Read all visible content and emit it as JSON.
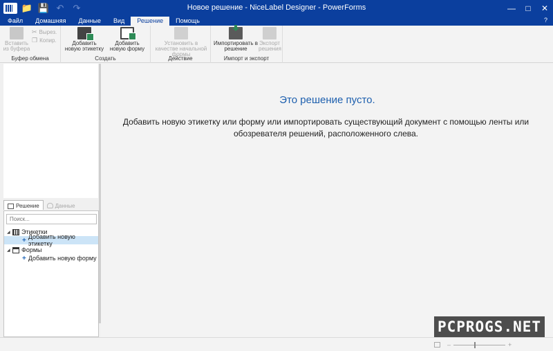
{
  "window": {
    "title": "Новое решение - NiceLabel Designer - PowerForms"
  },
  "titlebar_icons": [
    "app-logo-icon",
    "folder-open-icon",
    "save-icon",
    "undo-icon",
    "redo-icon"
  ],
  "menu": {
    "tabs": [
      {
        "label": "Файл",
        "active": false
      },
      {
        "label": "Домашняя",
        "active": false
      },
      {
        "label": "Данные",
        "active": false
      },
      {
        "label": "Вид",
        "active": false
      },
      {
        "label": "Решение",
        "active": true
      },
      {
        "label": "Помощь",
        "active": false
      }
    ],
    "help_mark": "?"
  },
  "ribbon": {
    "clipboard": {
      "group_label": "Буфер обмена",
      "paste_label": "Вставить из буфера",
      "cut_label": "Вырез.",
      "copy_label": "Копир."
    },
    "create": {
      "group_label": "Создать",
      "add_label": "Добавить новую этикетку",
      "add_form": "Добавить новую форму"
    },
    "action": {
      "group_label": "Действие",
      "set_start": "Установить в качестве начальной формы"
    },
    "import_export": {
      "group_label": "Импорт и экспорт",
      "import_label": "Импортировать в решение",
      "export_label": "Экспорт решения"
    }
  },
  "left_panel": {
    "tabs": [
      {
        "label": "Решение",
        "active": true
      },
      {
        "label": "Данные",
        "active": false
      }
    ],
    "search_placeholder": "Поиск...",
    "tree": {
      "labels_node": "Этикетки",
      "add_label_item": "Добавить новую этикетку",
      "forms_node": "Формы",
      "add_form_item": "Добавить новую форму"
    }
  },
  "main": {
    "empty_title": "Это решение пусто.",
    "empty_message": "Добавить новую этикетку или форму или импортировать существующий документ с помощью ленты или обозревателя решений, расположенного слева."
  },
  "statusbar": {
    "zoom_minus": "–",
    "zoom_plus": "+"
  },
  "watermark": {
    "text": "PCPROGS.NET"
  },
  "colors": {
    "titlebar": "#0b3f9e",
    "accent_text": "#1d5fae",
    "selection": "#cce4f7"
  }
}
